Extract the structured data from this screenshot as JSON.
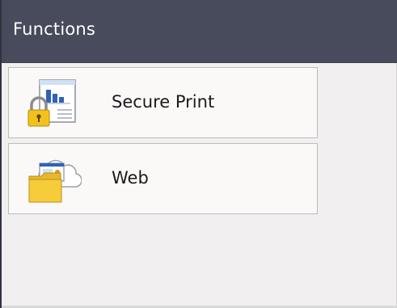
{
  "header": {
    "title": "Functions"
  },
  "tiles": [
    {
      "label": "Secure Print",
      "icon": "secure-print-icon"
    },
    {
      "label": "Web",
      "icon": "web-folder-icon"
    }
  ],
  "colors": {
    "header_bg": "#474b5c",
    "screen_bg": "#f1efef",
    "tile_bg": "#fbf8f8",
    "tile_border": "#bdbdbd",
    "lock_yellow": "#f2c21b",
    "folder_yellow": "#f7cc3b"
  }
}
